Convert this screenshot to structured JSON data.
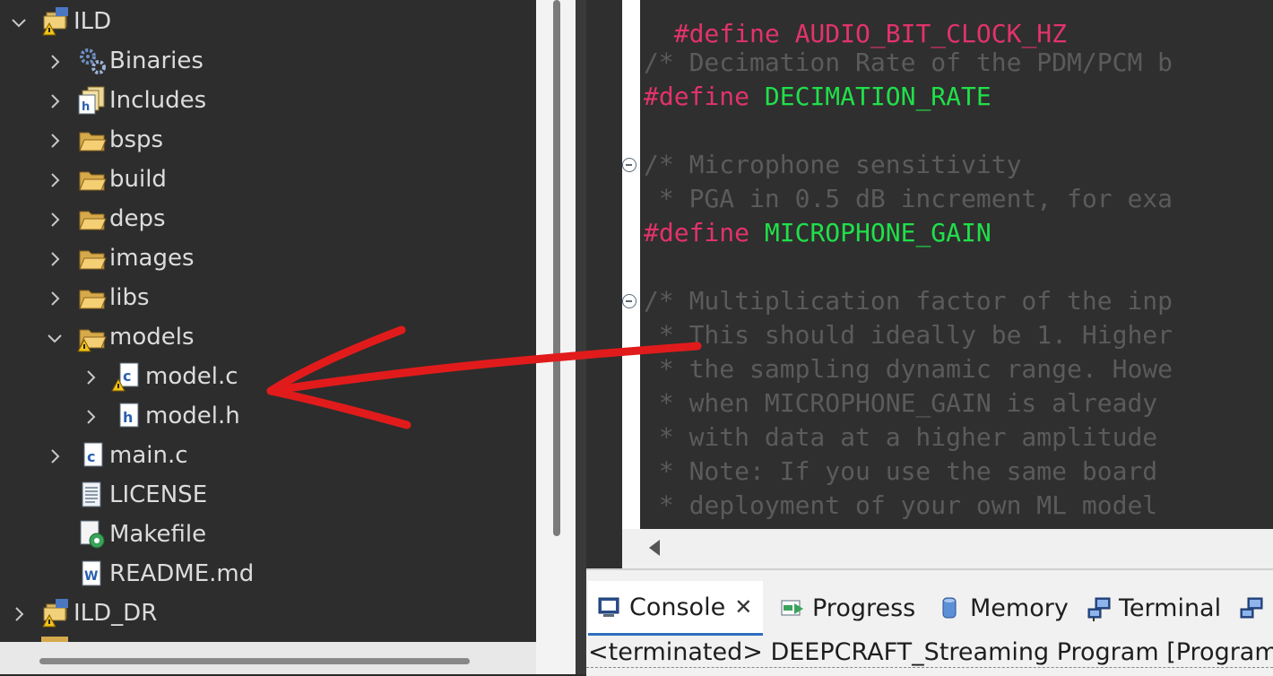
{
  "explorer": {
    "items": [
      {
        "label": "ILD",
        "icon": "project-warning-icon",
        "expanded": true
      },
      {
        "label": "Binaries",
        "icon": "binaries-icon"
      },
      {
        "label": "Includes",
        "icon": "includes-icon"
      },
      {
        "label": "bsps",
        "icon": "folder-icon"
      },
      {
        "label": "build",
        "icon": "folder-icon"
      },
      {
        "label": "deps",
        "icon": "folder-icon"
      },
      {
        "label": "images",
        "icon": "folder-icon"
      },
      {
        "label": "libs",
        "icon": "folder-icon"
      },
      {
        "label": "models",
        "icon": "folder-warning-icon",
        "expanded": true
      },
      {
        "label": "model.c",
        "icon": "c-file-warning-icon"
      },
      {
        "label": "model.h",
        "icon": "h-file-icon"
      },
      {
        "label": "main.c",
        "icon": "c-file-icon"
      },
      {
        "label": "LICENSE",
        "icon": "text-file-icon"
      },
      {
        "label": "Makefile",
        "icon": "makefile-icon"
      },
      {
        "label": "README.md",
        "icon": "markdown-file-icon"
      },
      {
        "label": "ILD_DR",
        "icon": "project-warning-icon"
      }
    ]
  },
  "editor": {
    "lines": [
      {
        "kind": "partial",
        "text": "#define AUDIO_BIT_CLOCK_HZ"
      },
      {
        "kind": "comment",
        "text": "/* Decimation Rate of the PDM/PCM b"
      },
      {
        "kind": "define",
        "kw": "#define",
        "name": "DECIMATION_RATE"
      },
      {
        "kind": "comment",
        "text": "/* Microphone sensitivity"
      },
      {
        "kind": "comment",
        "text": " * PGA in 0.5 dB increment, for exa"
      },
      {
        "kind": "define",
        "kw": "#define",
        "name": "MICROPHONE_GAIN"
      },
      {
        "kind": "comment",
        "text": "/* Multiplication factor of the inp"
      },
      {
        "kind": "comment",
        "text": " * This should ideally be 1. Higher"
      },
      {
        "kind": "comment",
        "text": " * the sampling dynamic range. Howe"
      },
      {
        "kind": "comment",
        "text": " * when MICROPHONE_GAIN is already"
      },
      {
        "kind": "comment",
        "text": " * with data at a higher amplitude"
      },
      {
        "kind": "comment",
        "text": " * Note: If you use the same board"
      },
      {
        "kind": "comment",
        "text": " * deployment of your own ML model"
      }
    ]
  },
  "console": {
    "tabs": [
      {
        "label": "Console",
        "icon": "console-icon",
        "active": true
      },
      {
        "label": "Progress",
        "icon": "progress-icon"
      },
      {
        "label": "Memory",
        "icon": "memory-icon"
      },
      {
        "label": "Terminal",
        "icon": "terminal-icon"
      }
    ],
    "close_glyph": "✕",
    "status": "<terminated> DEEPCRAFT_Streaming Program [Program]"
  },
  "annotation": {
    "type": "red-arrow",
    "points_to": "model.c"
  }
}
